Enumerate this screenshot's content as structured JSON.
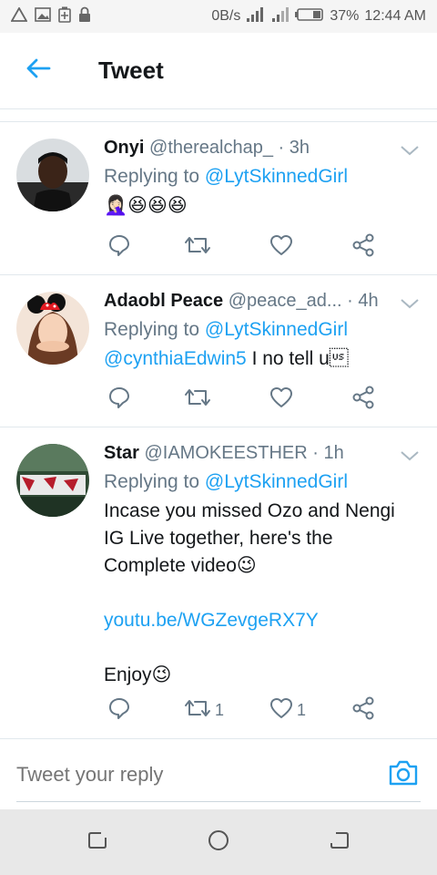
{
  "status_bar": {
    "speed": "0B/s",
    "battery": "37%",
    "time": "12:44 AM"
  },
  "header": {
    "title": "Tweet"
  },
  "tweets": [
    {
      "name": "Onyi",
      "handle": "@therealchap_",
      "time": "3h",
      "replying_prefix": "Replying to",
      "replying_to": "@LytSkinnedGirl",
      "text": "🤦🏻‍♀️😆😆😆"
    },
    {
      "name": "Adaobl Peace",
      "handle": "@peace_ad...",
      "time": "4h",
      "replying_prefix": "Replying to",
      "replying_to": "@LytSkinnedGirl",
      "text_mention": "@cynthiaEdwin5",
      "text": " I no tell u\u001f"
    },
    {
      "name": "Star",
      "handle": "@IAMOKEESTHER",
      "time": "1h",
      "replying_prefix": "Replying to",
      "replying_to": "@LytSkinnedGirl",
      "text_lines": [
        "Incase you missed Ozo and Nengi",
        "IG Live together,  here's the",
        "Complete video😉"
      ],
      "link": "youtu.be/WGZevgeRX7Y",
      "closing": "Enjoy😉",
      "retweets": "1",
      "likes": "1"
    }
  ],
  "reply": {
    "placeholder": "Tweet your reply"
  },
  "colors": {
    "accent": "#1da1f2",
    "secondary_text": "#657786",
    "divider": "#e1e8ed"
  },
  "icons": {
    "back": "arrow-left-icon",
    "reply": "comment-icon",
    "retweet": "retweet-icon",
    "like": "heart-icon",
    "share": "share-icon",
    "more": "chevron-down-icon",
    "camera": "camera-icon"
  }
}
